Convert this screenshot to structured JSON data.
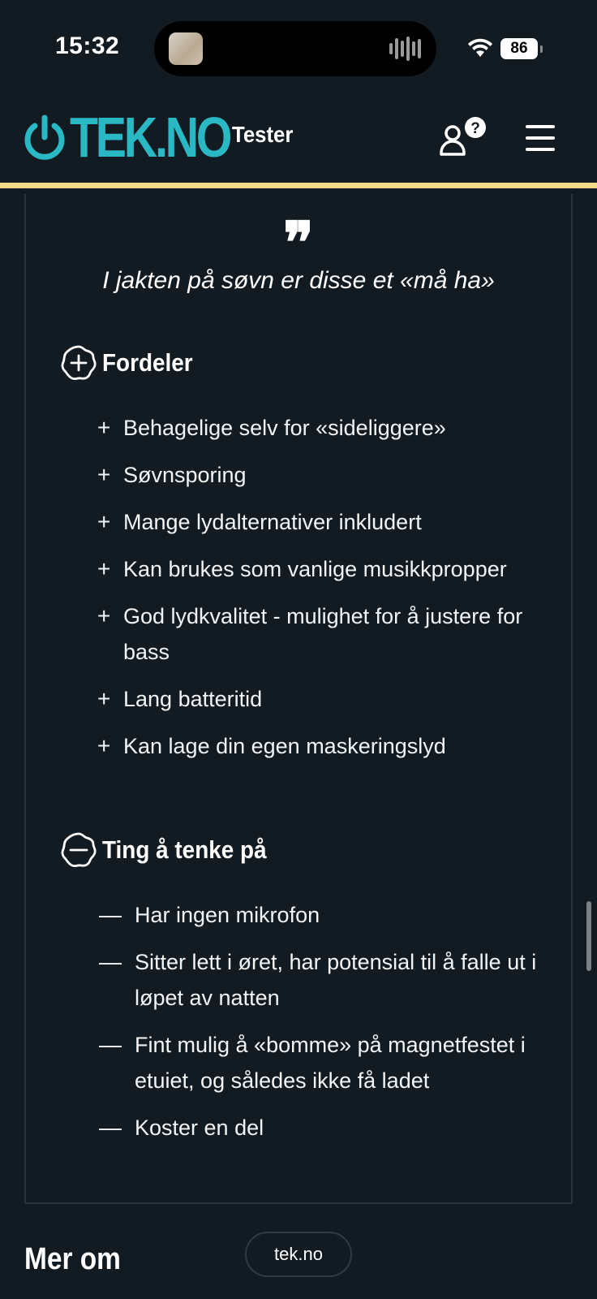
{
  "status_bar": {
    "time": "15:32",
    "battery_level": "86"
  },
  "header": {
    "logo_text": "TEK.NO",
    "section": "Tester",
    "colors": {
      "logo": "#2bb8c5",
      "underline": "#f4d98a",
      "background": "#121b22"
    },
    "icons": [
      "power-icon",
      "user-help-icon",
      "hamburger-menu-icon"
    ]
  },
  "review": {
    "quote_mark": "❞",
    "quote": "I jakten på søvn er disse et «må ha»",
    "pros": {
      "heading": "Fordeler",
      "marker": "+",
      "items": [
        "Behagelige selv for «sideliggere»",
        "Søvnsporing",
        "Mange lydalternativer inkludert",
        "Kan brukes som vanlige musikkpropper",
        "God lydkvalitet - mulighet for å justere for bass",
        "Lang batteritid",
        "Kan lage din egen maskeringslyd"
      ]
    },
    "cons": {
      "heading": "Ting å tenke på",
      "marker": "—",
      "items": [
        "Har ingen mikrofon",
        "Sitter lett i øret, har potensial til å falle ut i løpet av natten",
        "Fint mulig å «bomme» på magnetfestet i etuiet, og således ikke få ladet",
        "Koster en del"
      ]
    }
  },
  "footer": {
    "more_heading": "Mer om",
    "url_pill": "tek.no"
  }
}
